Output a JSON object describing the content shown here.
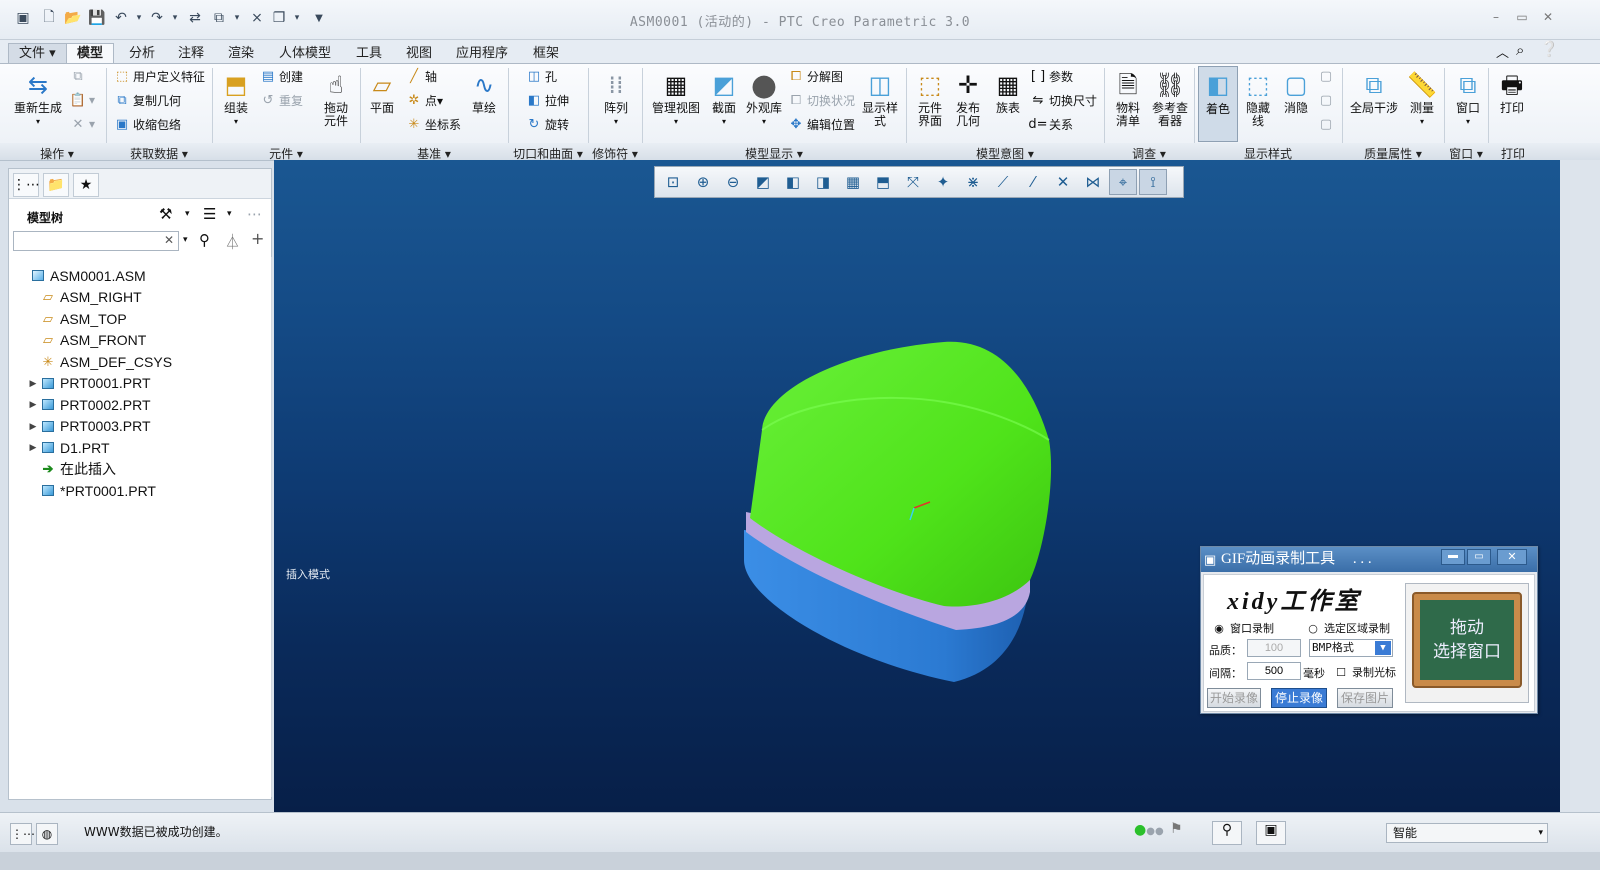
{
  "window": {
    "title": "ASM0001 (活动的) - PTC Creo Parametric 3.0"
  },
  "tabs": [
    "文件",
    "模型",
    "分析",
    "注释",
    "渲染",
    "人体模型",
    "工具",
    "视图",
    "应用程序",
    "框架"
  ],
  "ribbon": {
    "regenerate": "重新生成",
    "user_feature": "用户定义特征",
    "copy_geom": "复制几何",
    "shrinkwrap": "收缩包络",
    "assemble": "组装",
    "create": "创建",
    "repeat": "重复",
    "drag_line1": "拖动",
    "drag_line2": "元件",
    "plane": "平面",
    "axis": "轴",
    "point": "点",
    "csys": "坐标系",
    "sketch": "草绘",
    "hole": "孔",
    "extrude": "拉伸",
    "revolve": "旋转",
    "pattern": "阵列",
    "manage_views": "管理视图",
    "section": "截面",
    "appearance": "外观库",
    "explode": "分解图",
    "toggle_status": "切换状况",
    "edit_position": "编辑位置",
    "display_style_line1": "显示样",
    "display_style_line2": "式",
    "comp_iface_line1": "元件",
    "comp_iface_line2": "界面",
    "publish_line1": "发布",
    "publish_line2": "几何",
    "family_table": "族表",
    "params": "参数",
    "switch_dims": "切换尺寸",
    "relations": "关系",
    "bom_line1": "物料",
    "bom_line2": "清单",
    "ref_viewer_line1": "参考查",
    "ref_viewer_line2": "看器",
    "shading": "着色",
    "hidden_line1": "隐藏",
    "hidden_line2": "线",
    "no_hidden": "消隐",
    "global_interference": "全局干涉",
    "measure": "测量",
    "window": "窗口",
    "print": "打印"
  },
  "groups": [
    "操作",
    "获取数据",
    "元件",
    "基准",
    "切口和曲面",
    "修饰符",
    "模型显示",
    "模型意图",
    "调查",
    "显示样式",
    "质量属性",
    "窗口",
    "打印"
  ],
  "panel": {
    "title": "模型树",
    "search_value": "",
    "tree": [
      {
        "label": "ASM0001.ASM",
        "icon": "assembly-icon",
        "expand": "",
        "indent": 0
      },
      {
        "label": "ASM_RIGHT",
        "icon": "datum-plane-icon",
        "expand": "",
        "indent": 1
      },
      {
        "label": "ASM_TOP",
        "icon": "datum-plane-icon",
        "expand": "",
        "indent": 1
      },
      {
        "label": "ASM_FRONT",
        "icon": "datum-plane-icon",
        "expand": "",
        "indent": 1
      },
      {
        "label": "ASM_DEF_CSYS",
        "icon": "csys-icon",
        "expand": "",
        "indent": 1
      },
      {
        "label": "PRT0001.PRT",
        "icon": "part-icon",
        "expand": "▶",
        "indent": 1
      },
      {
        "label": "PRT0002.PRT",
        "icon": "part-icon",
        "expand": "▶",
        "indent": 1
      },
      {
        "label": "PRT0003.PRT",
        "icon": "part-icon",
        "expand": "▶",
        "indent": 1
      },
      {
        "label": "D1.PRT",
        "icon": "part-icon",
        "expand": "▶",
        "indent": 1
      },
      {
        "label": "在此插入",
        "icon": "insert-arrow-icon",
        "expand": "",
        "indent": 1
      },
      {
        "label": "*PRT0001.PRT",
        "icon": "part-icon",
        "expand": "",
        "indent": 1
      }
    ]
  },
  "viewport": {
    "mode_label": "插入模式"
  },
  "status": {
    "message": "WWW数据已被成功创建。",
    "filter_value": "智能"
  },
  "gif_tool": {
    "title": "GIF动画录制工具",
    "title_dots": ". . .",
    "brand": "xidy工作室",
    "radio_window": "窗口录制",
    "radio_region": "选定区域录制",
    "quality_label": "品质：",
    "quality_value": "100",
    "format_value": "BMP格式",
    "interval_label": "间隔：",
    "interval_value": "500",
    "ms_label": "毫秒",
    "record_cursor": "录制光标",
    "btn_start": "开始录像",
    "btn_stop": "停止录像",
    "btn_save": "保存图片",
    "drag_line1": "拖动",
    "drag_line2": "选择窗口"
  },
  "colors": {
    "viewport_top": "#1a5792",
    "viewport_bottom": "#071f48",
    "part_green": "#4fe31a",
    "part_lavender": "#b9a6e0",
    "part_blue": "#2f7fd9"
  }
}
